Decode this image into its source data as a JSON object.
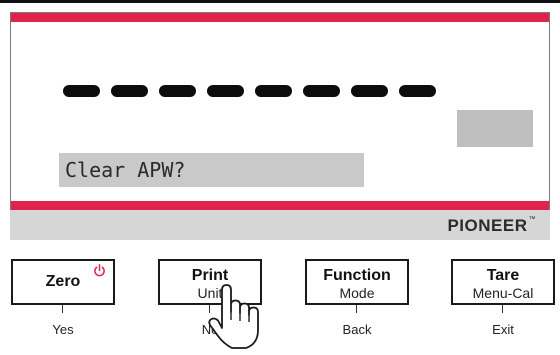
{
  "display": {
    "dash_count": 8,
    "prompt": "Clear APW?"
  },
  "brand": {
    "name": "PIONEER",
    "trademark": "™"
  },
  "keys": [
    {
      "main": "Zero",
      "sub": "",
      "below": "Yes"
    },
    {
      "main": "Print",
      "sub": "Unit",
      "below": "No"
    },
    {
      "main": "Function",
      "sub": "Mode",
      "below": "Back"
    },
    {
      "main": "Tare",
      "sub": "Menu-Cal",
      "below": "Exit"
    }
  ],
  "icons": {
    "power": "power-icon",
    "pointer": "hand-pointer-icon"
  },
  "colors": {
    "accent_red": "#e0234a",
    "segment_gray": "#c9c9c9",
    "brand_bar": "#d6d6d6"
  }
}
